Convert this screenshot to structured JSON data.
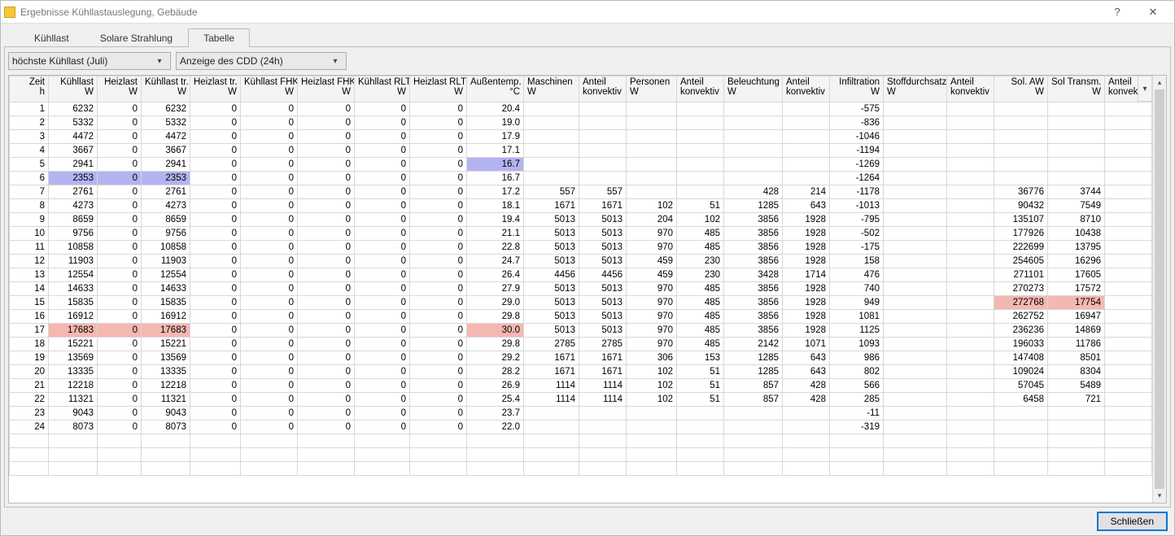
{
  "window": {
    "title": "Ergebnisse Kühllastauslegung, Gebäude",
    "help": "?",
    "close": "✕"
  },
  "tabs": [
    {
      "label": "Kühllast",
      "active": false
    },
    {
      "label": "Solare Strahlung",
      "active": false
    },
    {
      "label": "Tabelle",
      "active": true
    }
  ],
  "dropdowns": {
    "dd1": "höchste Kühllast (Juli)",
    "dd2": "Anzeige des CDD (24h)"
  },
  "columns": [
    {
      "l1": "Zeit",
      "l2": "h",
      "align": "num",
      "key": "zeit"
    },
    {
      "l1": "Kühllast",
      "l2": "W",
      "align": "num",
      "key": "kuehl"
    },
    {
      "l1": "Heizlast",
      "l2": "W",
      "align": "num",
      "key": "heiz"
    },
    {
      "l1": "Kühllast tr.",
      "l2": "W",
      "align": "num",
      "key": "kuehltr"
    },
    {
      "l1": "Heizlast tr.",
      "l2": "W",
      "align": "num",
      "key": "heiztr"
    },
    {
      "l1": "Kühllast FHK",
      "l2": "W",
      "align": "num",
      "key": "kfhk"
    },
    {
      "l1": "Heizlast FHK",
      "l2": "W",
      "align": "num",
      "key": "hfhk"
    },
    {
      "l1": "Kühllast RLT",
      "l2": "W",
      "align": "num",
      "key": "krlt"
    },
    {
      "l1": "Heizlast RLT",
      "l2": "W",
      "align": "num",
      "key": "hrlt"
    },
    {
      "l1": "Außentemp.",
      "l2": "°C",
      "align": "num",
      "key": "temp"
    },
    {
      "l1": "Maschinen",
      "l2": "W",
      "align": "txt",
      "key": "masch"
    },
    {
      "l1": "Anteil",
      "l2": "konvektiv",
      "align": "txt",
      "key": "ak1"
    },
    {
      "l1": "Personen",
      "l2": "W",
      "align": "txt",
      "key": "pers"
    },
    {
      "l1": "Anteil",
      "l2": "konvektiv",
      "align": "txt",
      "key": "ak2"
    },
    {
      "l1": "Beleuchtung",
      "l2": "W",
      "align": "txt",
      "key": "bel"
    },
    {
      "l1": "Anteil",
      "l2": "konvektiv",
      "align": "txt",
      "key": "ak3"
    },
    {
      "l1": "Infiltration",
      "l2": "W",
      "align": "num",
      "key": "inf"
    },
    {
      "l1": "Stoffdurchsatz",
      "l2": "W",
      "align": "txt",
      "key": "stoff"
    },
    {
      "l1": "Anteil",
      "l2": "konvektiv",
      "align": "txt",
      "key": "ak4"
    },
    {
      "l1": "Sol. AW",
      "l2": "W",
      "align": "num",
      "key": "solaw"
    },
    {
      "l1": "Sol Transm.",
      "l2": "W",
      "align": "num",
      "key": "soltr"
    },
    {
      "l1": "Anteil",
      "l2": "konvektiv",
      "align": "txt",
      "key": "ak5"
    }
  ],
  "rows": [
    {
      "zeit": "1",
      "kuehl": "6232",
      "heiz": "0",
      "kuehltr": "6232",
      "heiztr": "0",
      "kfhk": "0",
      "hfhk": "0",
      "krlt": "0",
      "hrlt": "0",
      "temp": "20.4",
      "masch": "",
      "ak1": "",
      "pers": "",
      "ak2": "",
      "bel": "",
      "ak3": "",
      "inf": "-575",
      "stoff": "",
      "ak4": "",
      "solaw": "",
      "soltr": "",
      "ak5": ""
    },
    {
      "zeit": "2",
      "kuehl": "5332",
      "heiz": "0",
      "kuehltr": "5332",
      "heiztr": "0",
      "kfhk": "0",
      "hfhk": "0",
      "krlt": "0",
      "hrlt": "0",
      "temp": "19.0",
      "masch": "",
      "ak1": "",
      "pers": "",
      "ak2": "",
      "bel": "",
      "ak3": "",
      "inf": "-836",
      "stoff": "",
      "ak4": "",
      "solaw": "",
      "soltr": "",
      "ak5": ""
    },
    {
      "zeit": "3",
      "kuehl": "4472",
      "heiz": "0",
      "kuehltr": "4472",
      "heiztr": "0",
      "kfhk": "0",
      "hfhk": "0",
      "krlt": "0",
      "hrlt": "0",
      "temp": "17.9",
      "masch": "",
      "ak1": "",
      "pers": "",
      "ak2": "",
      "bel": "",
      "ak3": "",
      "inf": "-1046",
      "stoff": "",
      "ak4": "",
      "solaw": "",
      "soltr": "",
      "ak5": ""
    },
    {
      "zeit": "4",
      "kuehl": "3667",
      "heiz": "0",
      "kuehltr": "3667",
      "heiztr": "0",
      "kfhk": "0",
      "hfhk": "0",
      "krlt": "0",
      "hrlt": "0",
      "temp": "17.1",
      "masch": "",
      "ak1": "",
      "pers": "",
      "ak2": "",
      "bel": "",
      "ak3": "",
      "inf": "-1194",
      "stoff": "",
      "ak4": "",
      "solaw": "",
      "soltr": "",
      "ak5": ""
    },
    {
      "zeit": "5",
      "kuehl": "2941",
      "heiz": "0",
      "kuehltr": "2941",
      "heiztr": "0",
      "kfhk": "0",
      "hfhk": "0",
      "krlt": "0",
      "hrlt": "0",
      "temp": "16.7",
      "masch": "",
      "ak1": "",
      "pers": "",
      "ak2": "",
      "bel": "",
      "ak3": "",
      "inf": "-1269",
      "stoff": "",
      "ak4": "",
      "solaw": "",
      "soltr": "",
      "ak5": "",
      "hl": {
        "temp": "hl-blue"
      }
    },
    {
      "zeit": "6",
      "kuehl": "2353",
      "heiz": "0",
      "kuehltr": "2353",
      "heiztr": "0",
      "kfhk": "0",
      "hfhk": "0",
      "krlt": "0",
      "hrlt": "0",
      "temp": "16.7",
      "masch": "",
      "ak1": "",
      "pers": "",
      "ak2": "",
      "bel": "",
      "ak3": "",
      "inf": "-1264",
      "stoff": "",
      "ak4": "",
      "solaw": "",
      "soltr": "",
      "ak5": "",
      "hl": {
        "kuehl": "hl-blue",
        "heiz": "hl-blue",
        "kuehltr": "hl-blue"
      }
    },
    {
      "zeit": "7",
      "kuehl": "2761",
      "heiz": "0",
      "kuehltr": "2761",
      "heiztr": "0",
      "kfhk": "0",
      "hfhk": "0",
      "krlt": "0",
      "hrlt": "0",
      "temp": "17.2",
      "masch": "557",
      "ak1": "557",
      "pers": "",
      "ak2": "",
      "bel": "428",
      "ak3": "214",
      "inf": "-1178",
      "stoff": "",
      "ak4": "",
      "solaw": "36776",
      "soltr": "3744",
      "ak5": ""
    },
    {
      "zeit": "8",
      "kuehl": "4273",
      "heiz": "0",
      "kuehltr": "4273",
      "heiztr": "0",
      "kfhk": "0",
      "hfhk": "0",
      "krlt": "0",
      "hrlt": "0",
      "temp": "18.1",
      "masch": "1671",
      "ak1": "1671",
      "pers": "102",
      "ak2": "51",
      "bel": "1285",
      "ak3": "643",
      "inf": "-1013",
      "stoff": "",
      "ak4": "",
      "solaw": "90432",
      "soltr": "7549",
      "ak5": ""
    },
    {
      "zeit": "9",
      "kuehl": "8659",
      "heiz": "0",
      "kuehltr": "8659",
      "heiztr": "0",
      "kfhk": "0",
      "hfhk": "0",
      "krlt": "0",
      "hrlt": "0",
      "temp": "19.4",
      "masch": "5013",
      "ak1": "5013",
      "pers": "204",
      "ak2": "102",
      "bel": "3856",
      "ak3": "1928",
      "inf": "-795",
      "stoff": "",
      "ak4": "",
      "solaw": "135107",
      "soltr": "8710",
      "ak5": ""
    },
    {
      "zeit": "10",
      "kuehl": "9756",
      "heiz": "0",
      "kuehltr": "9756",
      "heiztr": "0",
      "kfhk": "0",
      "hfhk": "0",
      "krlt": "0",
      "hrlt": "0",
      "temp": "21.1",
      "masch": "5013",
      "ak1": "5013",
      "pers": "970",
      "ak2": "485",
      "bel": "3856",
      "ak3": "1928",
      "inf": "-502",
      "stoff": "",
      "ak4": "",
      "solaw": "177926",
      "soltr": "10438",
      "ak5": ""
    },
    {
      "zeit": "11",
      "kuehl": "10858",
      "heiz": "0",
      "kuehltr": "10858",
      "heiztr": "0",
      "kfhk": "0",
      "hfhk": "0",
      "krlt": "0",
      "hrlt": "0",
      "temp": "22.8",
      "masch": "5013",
      "ak1": "5013",
      "pers": "970",
      "ak2": "485",
      "bel": "3856",
      "ak3": "1928",
      "inf": "-175",
      "stoff": "",
      "ak4": "",
      "solaw": "222699",
      "soltr": "13795",
      "ak5": ""
    },
    {
      "zeit": "12",
      "kuehl": "11903",
      "heiz": "0",
      "kuehltr": "11903",
      "heiztr": "0",
      "kfhk": "0",
      "hfhk": "0",
      "krlt": "0",
      "hrlt": "0",
      "temp": "24.7",
      "masch": "5013",
      "ak1": "5013",
      "pers": "459",
      "ak2": "230",
      "bel": "3856",
      "ak3": "1928",
      "inf": "158",
      "stoff": "",
      "ak4": "",
      "solaw": "254605",
      "soltr": "16296",
      "ak5": ""
    },
    {
      "zeit": "13",
      "kuehl": "12554",
      "heiz": "0",
      "kuehltr": "12554",
      "heiztr": "0",
      "kfhk": "0",
      "hfhk": "0",
      "krlt": "0",
      "hrlt": "0",
      "temp": "26.4",
      "masch": "4456",
      "ak1": "4456",
      "pers": "459",
      "ak2": "230",
      "bel": "3428",
      "ak3": "1714",
      "inf": "476",
      "stoff": "",
      "ak4": "",
      "solaw": "271101",
      "soltr": "17605",
      "ak5": ""
    },
    {
      "zeit": "14",
      "kuehl": "14633",
      "heiz": "0",
      "kuehltr": "14633",
      "heiztr": "0",
      "kfhk": "0",
      "hfhk": "0",
      "krlt": "0",
      "hrlt": "0",
      "temp": "27.9",
      "masch": "5013",
      "ak1": "5013",
      "pers": "970",
      "ak2": "485",
      "bel": "3856",
      "ak3": "1928",
      "inf": "740",
      "stoff": "",
      "ak4": "",
      "solaw": "270273",
      "soltr": "17572",
      "ak5": ""
    },
    {
      "zeit": "15",
      "kuehl": "15835",
      "heiz": "0",
      "kuehltr": "15835",
      "heiztr": "0",
      "kfhk": "0",
      "hfhk": "0",
      "krlt": "0",
      "hrlt": "0",
      "temp": "29.0",
      "masch": "5013",
      "ak1": "5013",
      "pers": "970",
      "ak2": "485",
      "bel": "3856",
      "ak3": "1928",
      "inf": "949",
      "stoff": "",
      "ak4": "",
      "solaw": "272768",
      "soltr": "17754",
      "ak5": "",
      "hl": {
        "solaw": "hl-red",
        "soltr": "hl-red"
      }
    },
    {
      "zeit": "16",
      "kuehl": "16912",
      "heiz": "0",
      "kuehltr": "16912",
      "heiztr": "0",
      "kfhk": "0",
      "hfhk": "0",
      "krlt": "0",
      "hrlt": "0",
      "temp": "29.8",
      "masch": "5013",
      "ak1": "5013",
      "pers": "970",
      "ak2": "485",
      "bel": "3856",
      "ak3": "1928",
      "inf": "1081",
      "stoff": "",
      "ak4": "",
      "solaw": "262752",
      "soltr": "16947",
      "ak5": ""
    },
    {
      "zeit": "17",
      "kuehl": "17683",
      "heiz": "0",
      "kuehltr": "17683",
      "heiztr": "0",
      "kfhk": "0",
      "hfhk": "0",
      "krlt": "0",
      "hrlt": "0",
      "temp": "30.0",
      "masch": "5013",
      "ak1": "5013",
      "pers": "970",
      "ak2": "485",
      "bel": "3856",
      "ak3": "1928",
      "inf": "1125",
      "stoff": "",
      "ak4": "",
      "solaw": "236236",
      "soltr": "14869",
      "ak5": "",
      "hl": {
        "kuehl": "hl-red",
        "heiz": "hl-red",
        "kuehltr": "hl-red",
        "temp": "hl-red"
      }
    },
    {
      "zeit": "18",
      "kuehl": "15221",
      "heiz": "0",
      "kuehltr": "15221",
      "heiztr": "0",
      "kfhk": "0",
      "hfhk": "0",
      "krlt": "0",
      "hrlt": "0",
      "temp": "29.8",
      "masch": "2785",
      "ak1": "2785",
      "pers": "970",
      "ak2": "485",
      "bel": "2142",
      "ak3": "1071",
      "inf": "1093",
      "stoff": "",
      "ak4": "",
      "solaw": "196033",
      "soltr": "11786",
      "ak5": ""
    },
    {
      "zeit": "19",
      "kuehl": "13569",
      "heiz": "0",
      "kuehltr": "13569",
      "heiztr": "0",
      "kfhk": "0",
      "hfhk": "0",
      "krlt": "0",
      "hrlt": "0",
      "temp": "29.2",
      "masch": "1671",
      "ak1": "1671",
      "pers": "306",
      "ak2": "153",
      "bel": "1285",
      "ak3": "643",
      "inf": "986",
      "stoff": "",
      "ak4": "",
      "solaw": "147408",
      "soltr": "8501",
      "ak5": ""
    },
    {
      "zeit": "20",
      "kuehl": "13335",
      "heiz": "0",
      "kuehltr": "13335",
      "heiztr": "0",
      "kfhk": "0",
      "hfhk": "0",
      "krlt": "0",
      "hrlt": "0",
      "temp": "28.2",
      "masch": "1671",
      "ak1": "1671",
      "pers": "102",
      "ak2": "51",
      "bel": "1285",
      "ak3": "643",
      "inf": "802",
      "stoff": "",
      "ak4": "",
      "solaw": "109024",
      "soltr": "8304",
      "ak5": ""
    },
    {
      "zeit": "21",
      "kuehl": "12218",
      "heiz": "0",
      "kuehltr": "12218",
      "heiztr": "0",
      "kfhk": "0",
      "hfhk": "0",
      "krlt": "0",
      "hrlt": "0",
      "temp": "26.9",
      "masch": "1114",
      "ak1": "1114",
      "pers": "102",
      "ak2": "51",
      "bel": "857",
      "ak3": "428",
      "inf": "566",
      "stoff": "",
      "ak4": "",
      "solaw": "57045",
      "soltr": "5489",
      "ak5": ""
    },
    {
      "zeit": "22",
      "kuehl": "11321",
      "heiz": "0",
      "kuehltr": "11321",
      "heiztr": "0",
      "kfhk": "0",
      "hfhk": "0",
      "krlt": "0",
      "hrlt": "0",
      "temp": "25.4",
      "masch": "1114",
      "ak1": "1114",
      "pers": "102",
      "ak2": "51",
      "bel": "857",
      "ak3": "428",
      "inf": "285",
      "stoff": "",
      "ak4": "",
      "solaw": "6458",
      "soltr": "721",
      "ak5": ""
    },
    {
      "zeit": "23",
      "kuehl": "9043",
      "heiz": "0",
      "kuehltr": "9043",
      "heiztr": "0",
      "kfhk": "0",
      "hfhk": "0",
      "krlt": "0",
      "hrlt": "0",
      "temp": "23.7",
      "masch": "",
      "ak1": "",
      "pers": "",
      "ak2": "",
      "bel": "",
      "ak3": "",
      "inf": "-11",
      "stoff": "",
      "ak4": "",
      "solaw": "",
      "soltr": "",
      "ak5": ""
    },
    {
      "zeit": "24",
      "kuehl": "8073",
      "heiz": "0",
      "kuehltr": "8073",
      "heiztr": "0",
      "kfhk": "0",
      "hfhk": "0",
      "krlt": "0",
      "hrlt": "0",
      "temp": "22.0",
      "masch": "",
      "ak1": "",
      "pers": "",
      "ak2": "",
      "bel": "",
      "ak3": "",
      "inf": "-319",
      "stoff": "",
      "ak4": "",
      "solaw": "",
      "soltr": "",
      "ak5": ""
    }
  ],
  "emptyRows": 3,
  "footer": {
    "close": "Schließen"
  }
}
